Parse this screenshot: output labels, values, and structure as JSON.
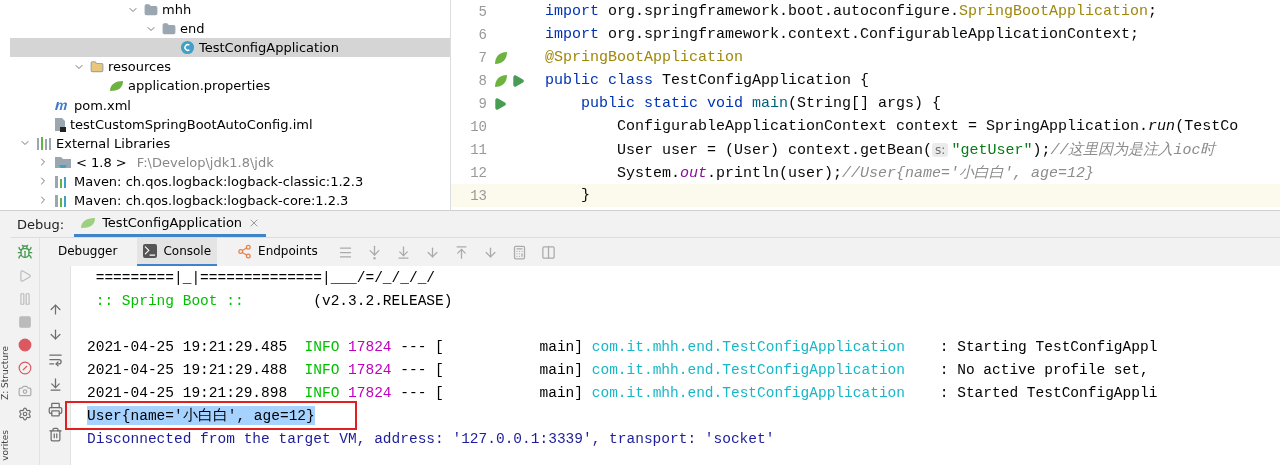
{
  "project_tree": [
    {
      "children": [
        {
          "children": [
            {
              "children": [
                {
                  "children": [
                    {
                      "children": [
                        {
                          "children": [
                            {
                              "label": "mhh",
                              "kind": "package",
                              "expanded": true,
                              "selected": false,
                              "children": [
                                {
                                  "label": "end",
                                  "kind": "package",
                                  "expanded": true,
                                  "selected": false,
                                  "children": [
                                    {
                                      "label": "TestConfigApplication",
                                      "kind": "class",
                                      "selected": true
                                    }
                                  ]
                                }
                              ]
                            }
                          ]
                        }
                      ]
                    }
                  ]
                },
                {
                  "label": "resources",
                  "kind": "folder",
                  "expanded": true,
                  "selected": false,
                  "children": [
                    {
                      "label": "application.properties",
                      "kind": "properties",
                      "selected": false
                    }
                  ]
                }
              ]
            }
          ]
        },
        {
          "label": "pom.xml",
          "kind": "pom",
          "selected": false
        },
        {
          "label": "testCustomSpringBootAutoConfig.iml",
          "kind": "module",
          "selected": false
        }
      ]
    },
    {
      "label": "External Libraries",
      "kind": "libraries",
      "expanded": true,
      "selected": false,
      "children": [
        {
          "label": "< 1.8 >",
          "detail": "F:\\Develop\\jdk1.8\\jdk",
          "kind": "jdk",
          "expanded": false,
          "selected": false
        },
        {
          "label": "Maven: ch.qos.logback:logback-classic:1.2.3",
          "kind": "library",
          "expanded": false,
          "selected": false
        },
        {
          "label": "Maven: ch.qos.logback:logback-core:1.2.3",
          "kind": "library",
          "expanded": false,
          "selected": false
        }
      ]
    }
  ],
  "editor": {
    "lines": [
      {
        "number": "5",
        "current": false,
        "tokens": [
          {
            "kind": "keyword",
            "text": "import"
          },
          {
            "kind": "plain",
            "text": " org.springframework.boot.autoconfigure."
          },
          {
            "kind": "annotation",
            "text": "SpringBootApplication"
          },
          {
            "kind": "plain",
            "text": ";"
          }
        ]
      },
      {
        "number": "6",
        "current": false,
        "tokens": [
          {
            "kind": "keyword",
            "text": "import"
          },
          {
            "kind": "plain",
            "text": " org.springframework.context.ConfigurableApplicationContext;"
          }
        ]
      },
      {
        "number": "7",
        "current": false,
        "markers": [
          {
            "kind": "bean"
          }
        ],
        "tokens": [
          {
            "kind": "annotation",
            "text": "@SpringBootApplication"
          }
        ]
      },
      {
        "number": "8",
        "current": false,
        "markers": [
          {
            "kind": "bean"
          },
          {
            "kind": "run"
          }
        ],
        "tokens": [
          {
            "kind": "keyword",
            "text": "public class"
          },
          {
            "kind": "plain",
            "text": " TestConfigApplication {"
          }
        ]
      },
      {
        "number": "9",
        "current": false,
        "markers": [
          {
            "kind": "run"
          }
        ],
        "tokens": [
          {
            "kind": "keyword",
            "text": "    public static void"
          },
          {
            "kind": "method",
            "text": " main"
          },
          {
            "kind": "plain",
            "text": "(String[] args) {"
          }
        ]
      },
      {
        "number": "10",
        "current": false,
        "tokens": [
          {
            "kind": "plain",
            "text": "        ConfigurableApplicationContext context = SpringApplication."
          },
          {
            "kind": "italic",
            "text": "run"
          },
          {
            "kind": "plain",
            "text": "(TestCo"
          }
        ]
      },
      {
        "number": "11",
        "current": false,
        "tokens": [
          {
            "kind": "plain",
            "text": "        User user = (User) context.getBean("
          },
          {
            "kind": "hint",
            "text": "s:"
          },
          {
            "kind": "string",
            "text": "\"getUser\""
          },
          {
            "kind": "plain",
            "text": ");"
          },
          {
            "kind": "comment",
            "text": "//这里因为是注入ioc时"
          }
        ]
      },
      {
        "number": "12",
        "current": false,
        "tokens": [
          {
            "kind": "plain",
            "text": "        System."
          },
          {
            "kind": "field",
            "text": "out"
          },
          {
            "kind": "plain",
            "text": ".println(user);"
          },
          {
            "kind": "comment",
            "text": "//User{name='小白白', age=12}"
          }
        ]
      },
      {
        "number": "13",
        "current": true,
        "tokens": [
          {
            "kind": "plain",
            "text": "    }"
          }
        ]
      }
    ]
  },
  "side_strip": [
    "Z: Structure",
    "vorites"
  ],
  "debug": {
    "label": "Debug:",
    "tabs": [
      {
        "label": "TestConfigApplication",
        "selected": true
      }
    ],
    "subtabs": [
      {
        "label": "Debugger",
        "kind": "debugger",
        "selected": false
      },
      {
        "label": "Console",
        "kind": "console",
        "selected": true
      },
      {
        "label": "Endpoints",
        "kind": "endpoints",
        "selected": false
      }
    ],
    "console": [
      {
        "kind": "banner",
        "text": " =========|_|==============|___/=/_/_/_/"
      },
      {
        "kind": "boot",
        "name": " :: Spring Boot :: ",
        "version": "       (v2.3.2.RELEASE)"
      },
      {
        "kind": "blank"
      },
      {
        "kind": "log",
        "time": "2021-04-25 19:21:29.485",
        "level": " INFO",
        "pid": "17824",
        "sep": "--- [",
        "thread": "           main]",
        "logger": "com.it.mhh.end.TestConfigApplication",
        "message": "    : Starting TestConfigAppl"
      },
      {
        "kind": "log",
        "time": "2021-04-25 19:21:29.488",
        "level": " INFO",
        "pid": "17824",
        "sep": "--- [",
        "thread": "           main]",
        "logger": "com.it.mhh.end.TestConfigApplication",
        "message": "    : No active profile set,"
      },
      {
        "kind": "log",
        "time": "2021-04-25 19:21:29.898",
        "level": " INFO",
        "pid": "17824",
        "sep": "--- [",
        "thread": "           main]",
        "logger": "com.it.mhh.end.TestConfigApplication",
        "message": "    : Started TestConfigAppli"
      },
      {
        "kind": "output",
        "text": "User{name='小白白', age=12}",
        "selected": true,
        "boxed": true
      },
      {
        "kind": "system",
        "text": "Disconnected from the target VM, address: '127.0.0.1:3339', transport: 'socket'"
      }
    ]
  }
}
